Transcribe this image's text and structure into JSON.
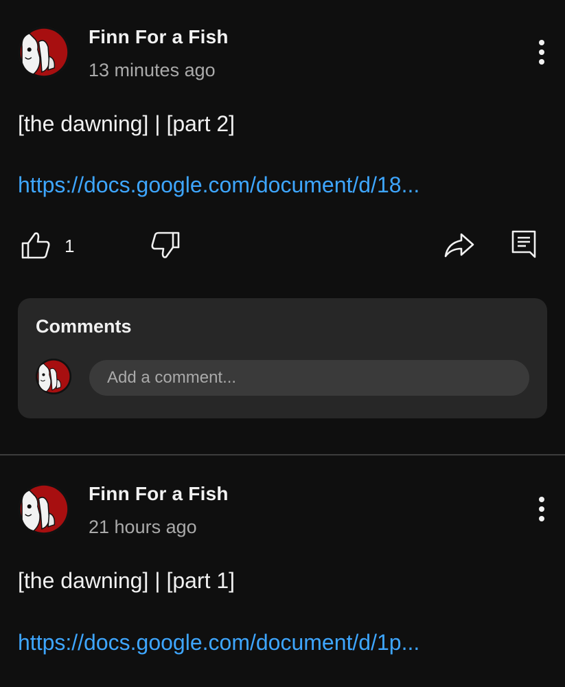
{
  "posts": [
    {
      "author": "Finn For a Fish",
      "time": "13 minutes ago",
      "text": "[the dawning] | [part 2]",
      "link": "https://docs.google.com/document/d/18...",
      "likes": "1"
    },
    {
      "author": "Finn For a Fish",
      "time": "21 hours ago",
      "text": "[the dawning] | [part 1]",
      "link": "https://docs.google.com/document/d/1p..."
    }
  ],
  "comments": {
    "title": "Comments",
    "placeholder": "Add a comment..."
  },
  "icons": {
    "avatar": "avatar-icon",
    "menu": "more-vertical-icon",
    "like": "thumbs-up-icon",
    "dislike": "thumbs-down-icon",
    "share": "share-icon",
    "comment": "comment-icon"
  },
  "colors": {
    "background": "#0f0f0f",
    "link": "#3ea6ff",
    "panel": "#272727",
    "avatar_red": "#b01010"
  }
}
